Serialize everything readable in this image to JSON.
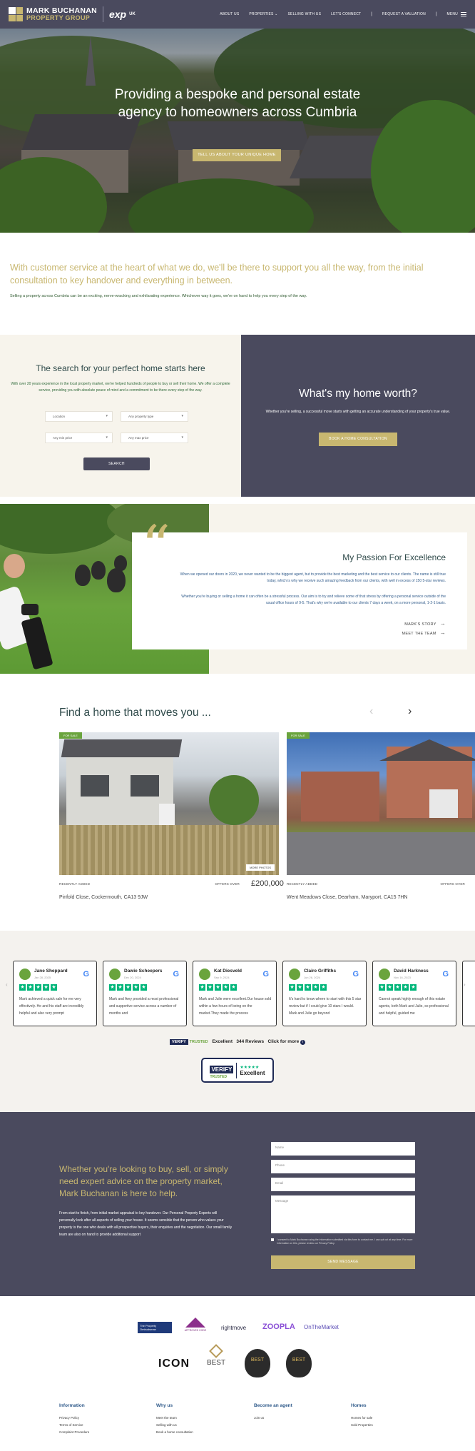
{
  "header": {
    "brand_line1": "MARK BUCHANAN",
    "brand_line2": "PROPERTY GROUP",
    "partner": "exp",
    "partner_region": "UK",
    "nav": [
      "ABOUT US",
      "PROPERTIES",
      "SELLING WITH US",
      "LET'S CONNECT",
      "REQUEST A VALUATION"
    ],
    "menu_label": "MENU"
  },
  "hero": {
    "title": "Providing a bespoke and personal estate agency to homeowners across Cumbria",
    "cta": "TELL US ABOUT YOUR UNIQUE HOME"
  },
  "intro": {
    "lead": "With customer service at the heart of what we do, we'll be there to support you all the way, from the initial consultation to key handover and everything in between.",
    "body": "Selling a property across Cumbria can be an exciting, nerve-wracking and exhilarating experience. Whichever way it goes, we're on hand to help you every step of the way."
  },
  "search": {
    "title": "The search for your perfect home starts here",
    "text": "With over 20 years experience in the local property market, we've helped hundreds of people to buy or sell their home. We offer a complete service, providing you with absolute peace of mind and a commitment to be there every step of the way.",
    "location": "Location",
    "type": "Any property type",
    "min_price": "Any min price",
    "max_price": "Any max price",
    "button": "SEARCH"
  },
  "worth": {
    "title": "What's my home worth?",
    "text": "Whether you're selling, a successful move starts with getting an accurate understanding of your property's true value.",
    "button": "BOOK A HOME CONSULTATION"
  },
  "passion": {
    "title": "My Passion For Excellence",
    "p1": "When we opened our doors in 2020, we never wanted to be the biggest agent, but to provide the best marketing and the best service to our clients. The name is still true today, which is why we receive such amazing feedback from our clients, with well in excess of 150 5-star reviews.",
    "p2": "Whether you're buying or selling a home it can often be a stressful process. Our aim is to try and relieve some of that stress by offering a personal service outside of the usual office hours of 9-5. That's why we're available to our clients 7 days a week, on a more personal, 1-2-1 basis.",
    "link1": "MARK'S STORY",
    "link2": "MEET THE TEAM"
  },
  "properties": {
    "title": "Find a home that moves you ...",
    "cards": [
      {
        "tag": "FOR SALE",
        "more": "MORE PHOTOS",
        "status": "RECENTLY ADDED",
        "offers": "OFFERS OVER",
        "price": "£200,000",
        "address": "Pinfold Close, Cockermouth, CA13 9JW"
      },
      {
        "tag": "FOR SALE",
        "status": "RECENTLY ADDED",
        "offers": "OFFERS OVER",
        "address": "Went Meadows Close, Dearham, Maryport, CA15 7HN"
      }
    ]
  },
  "reviews": {
    "items": [
      {
        "name": "Jane Sheppard",
        "date": "Jan 28, 2025",
        "text": "Mark achieved a quick sale for me very effectively. He and his staff are incredibly helpful and also very prompt"
      },
      {
        "name": "Dawie Scheepers",
        "date": "Dec 20, 2024",
        "text": "Mark and Amy provided a most professional and supportive service across a number of months and"
      },
      {
        "name": "Kat Diesveld",
        "date": "Sep 9, 2024",
        "text": "Mark and Julie were excellent.Our house sold within a few hours of being on the market.They made the process"
      },
      {
        "name": "Claire Griffiths",
        "date": "Jun 26, 2024",
        "text": "It's hard to know where to start with this 5 star review but if I could give 10 stars I would. Mark and Julie go beyond"
      },
      {
        "name": "David Harkness",
        "date": "Nov 16, 2023",
        "text": "Cannot speak highly enough of this estate agents, both Mark and Julie, so professional and helpful, guided me"
      }
    ],
    "verify": "VERIFY",
    "trusted": "TRUSTED",
    "rating": "Excellent",
    "count": "344 Reviews",
    "more": "Click for more"
  },
  "contact": {
    "lead": "Whether you're looking to buy, sell, or simply need expert advice on the property market, Mark Buchanan is here to help.",
    "body": "From start to finish, from initial market appraisal to key handover. Our Personal Property Experts will personally look after all aspects of selling your house. It seems sensible that the person who values your property is the one who deals with all prospective buyers, their enquiries and the negotiation. Our small family team are also on hand to provide additional support",
    "name": "Name",
    "phone": "Phone",
    "email": "Email",
    "message": "Message",
    "consent": "I consent to Mark Buchanan using the information submitted via this form to contact me. I can opt out at any time. For more information on this, please review our Privacy Policy.",
    "button": "SEND MESSAGE"
  },
  "logos": [
    "The Property Ombudsman",
    "APPROVED CODE",
    "rightmove",
    "ZOOPLA",
    "OnTheMarket",
    "ICON",
    "BEST",
    "BEST",
    "BEST"
  ],
  "footer": {
    "col1": {
      "title": "Information",
      "links": [
        "Privacy Policy",
        "Terms of Service",
        "Complaint Procedure"
      ]
    },
    "col2": {
      "title": "Why us",
      "links": [
        "Meet the team",
        "Selling with us",
        "Book a home consultation"
      ]
    },
    "col3": {
      "title": "Become an agent",
      "links": [
        "Join us"
      ]
    },
    "col4": {
      "title": "Homes",
      "links": [
        "Homes for sale",
        "Sold Properties"
      ]
    }
  }
}
